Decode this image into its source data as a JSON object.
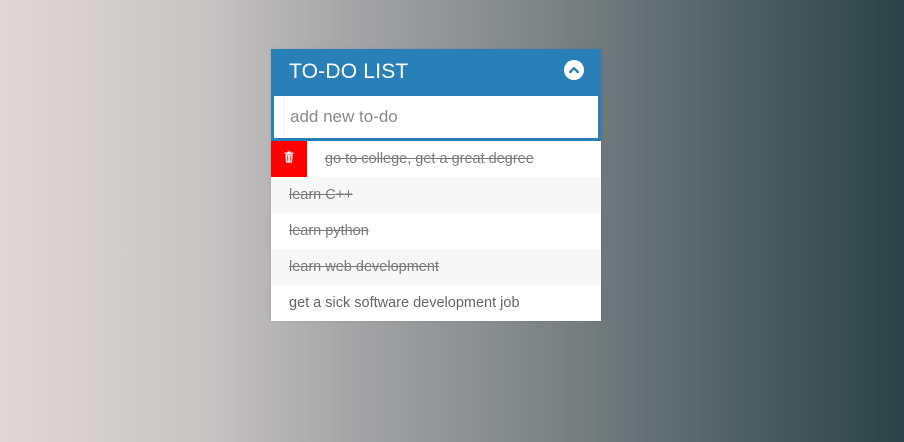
{
  "app": {
    "title": "TO-DO LIST",
    "toggle_icon": "chevron-up-circle-icon",
    "accent_color": "#2980b9",
    "delete_color": "#ff0000"
  },
  "input": {
    "placeholder": "add new to-do",
    "value": ""
  },
  "todos": [
    {
      "text": "go to college, get a great degree",
      "done": true,
      "hovered": true,
      "delete_icon": "trash-icon"
    },
    {
      "text": "learn C++",
      "done": true,
      "hovered": false
    },
    {
      "text": "learn python",
      "done": true,
      "hovered": false
    },
    {
      "text": "learn web development",
      "done": true,
      "hovered": false
    },
    {
      "text": "get a sick software development job",
      "done": false,
      "hovered": false
    }
  ]
}
